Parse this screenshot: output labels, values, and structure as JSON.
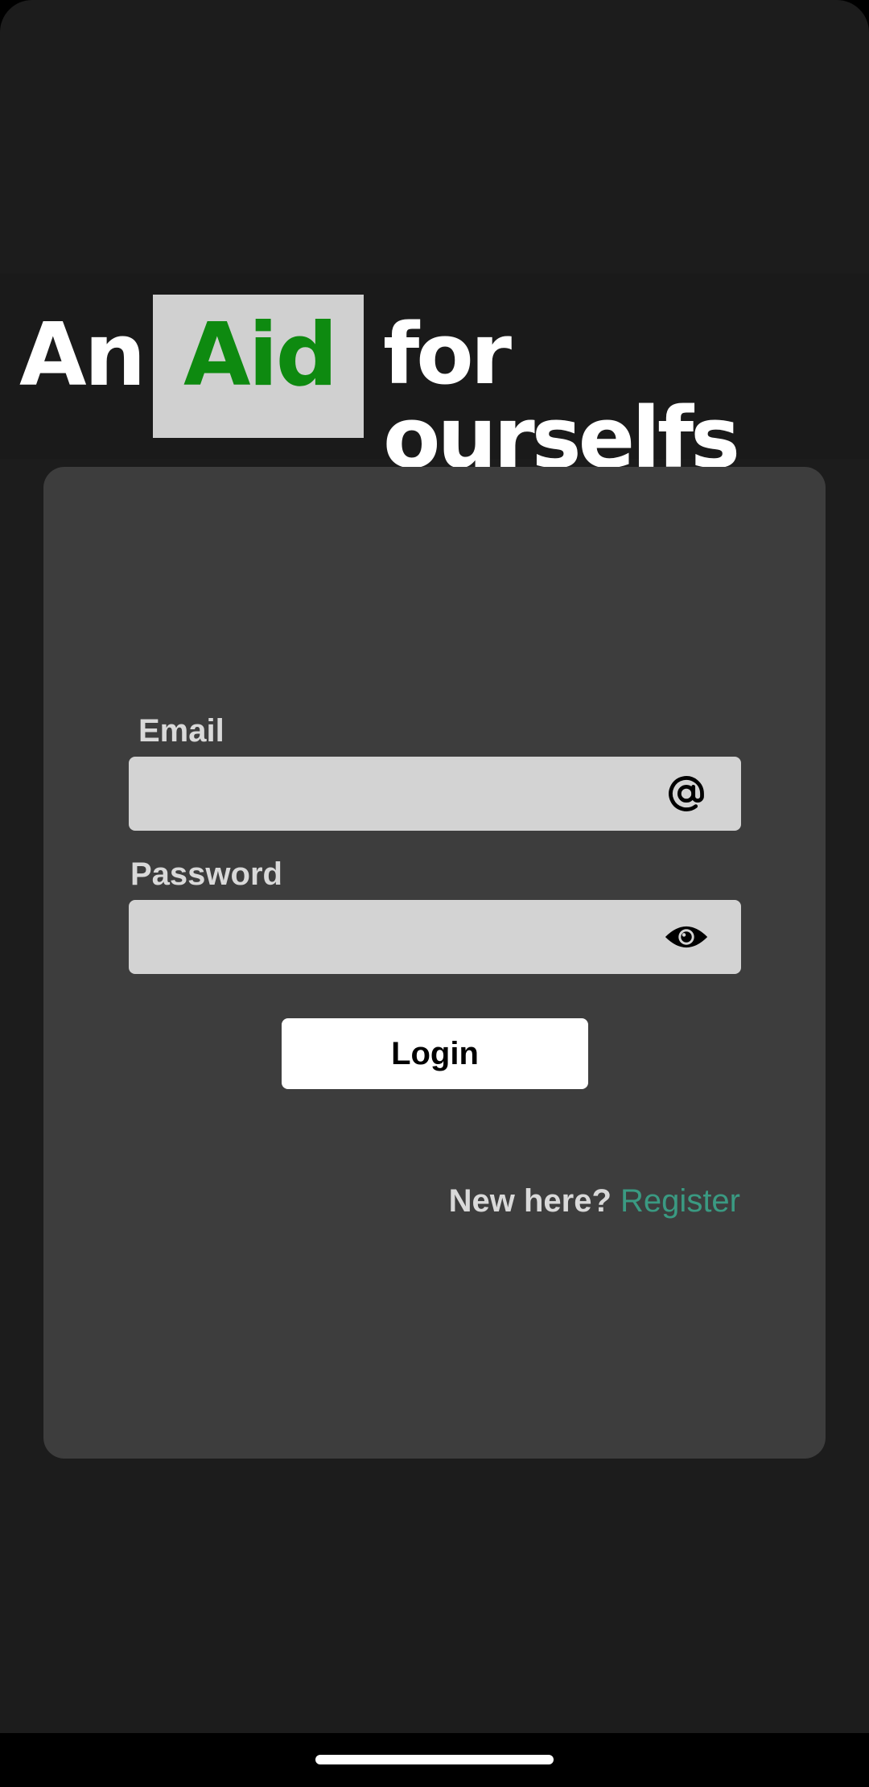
{
  "logo": {
    "word_an": "An",
    "word_aid": "Aid",
    "word_rest": "for ourselfs",
    "aid_color": "#0e8a10",
    "aid_box_color": "#d0d0d0"
  },
  "form": {
    "email_label": "Email",
    "email_value": "",
    "email_icon": "at-icon",
    "password_label": "Password",
    "password_value": "",
    "password_icon": "eye-icon",
    "login_label": "Login"
  },
  "register": {
    "prompt": "New here?",
    "link_label": "Register",
    "link_color": "#3a9a82"
  },
  "colors": {
    "background": "#1c1c1c",
    "card": "#3d3d3d",
    "field": "#d3d3d3"
  }
}
